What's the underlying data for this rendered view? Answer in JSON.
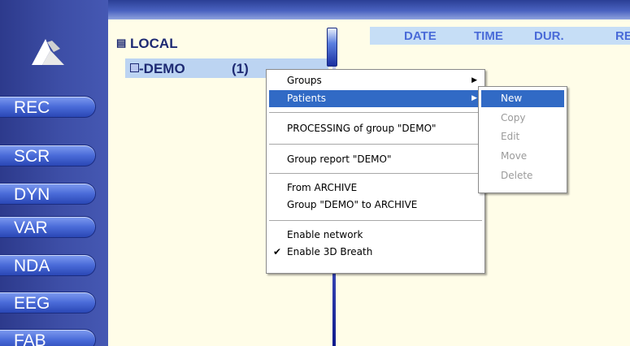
{
  "nav": [
    "REC",
    "SCR",
    "DYN",
    "VAR",
    "NDA",
    "EEG",
    "FAB"
  ],
  "tree": {
    "root_label": "LOCAL",
    "group_label": "DEMO",
    "group_count": "(1)"
  },
  "columns": [
    "DATE",
    "TIME",
    "DUR.",
    "RE"
  ],
  "context_menu": {
    "groups": "Groups",
    "patients": "Patients",
    "processing": "PROCESSING of group \"DEMO\"",
    "group_report": "Group report \"DEMO\"",
    "from_archive": "From ARCHIVE",
    "to_archive": "Group \"DEMO\" to ARCHIVE",
    "enable_network": "Enable network",
    "enable_3d_breath": "Enable 3D Breath",
    "checkmark": "✔",
    "submenu_arrow": "▶"
  },
  "submenu": {
    "new": "New",
    "copy": "Copy",
    "edit": "Edit",
    "move": "Move",
    "delete": "Delete"
  },
  "colors": {
    "sidebar": "#3d4ea6",
    "main_bg": "#fffde8",
    "menu_highlight": "#316ac5",
    "header_text": "#4a6bd8"
  }
}
